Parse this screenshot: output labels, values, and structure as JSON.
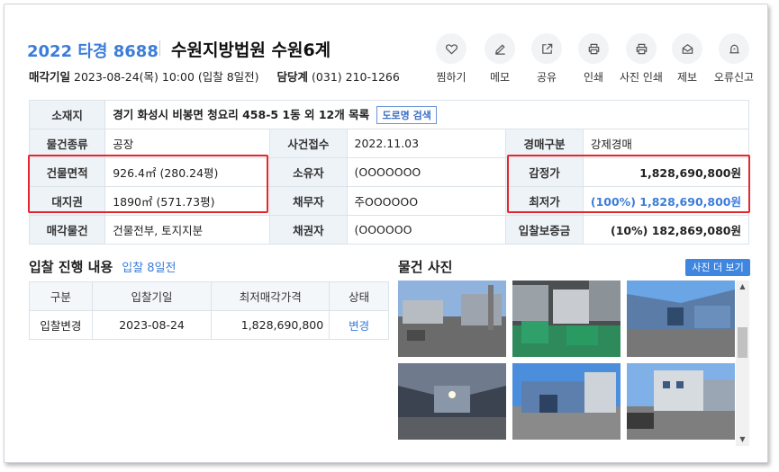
{
  "header": {
    "case_no": "2022 타경 8688",
    "court": "수원지방법원 수원6계",
    "sale_date_label": "매각기일",
    "sale_date": "2023-08-24(목) 10:00 (입찰 8일전)",
    "manager_label": "담당계",
    "manager_phone": "(031) 210-1266"
  },
  "actions": [
    {
      "label": "찜하기",
      "icon": "heart-icon"
    },
    {
      "label": "메모",
      "icon": "edit-icon"
    },
    {
      "label": "공유",
      "icon": "share-icon"
    },
    {
      "label": "인쇄",
      "icon": "print-icon"
    },
    {
      "label": "사진 인쇄",
      "icon": "print-icon"
    },
    {
      "label": "제보",
      "icon": "mail-icon"
    },
    {
      "label": "오류신고",
      "icon": "alert-icon"
    }
  ],
  "info": {
    "location_label": "소재지",
    "location": "경기 화성시 비봉면 청요리 458-5 1동 외 12개 목록",
    "road_btn": "도로명 검색",
    "type_label": "물건종류",
    "type": "공장",
    "accept_label": "사건접수",
    "accept": "2022.11.03",
    "auction_kind_label": "경매구분",
    "auction_kind": "강제경매",
    "bldg_area_label": "건물면적",
    "bldg_area": "926.4㎡ (280.24평)",
    "owner_label": "소유자",
    "owner": "(OOOOOOO",
    "appraisal_label": "감정가",
    "appraisal": "1,828,690,800원",
    "land_label": "대지권",
    "land": "1890㎡ (571.73평)",
    "debtor_label": "채무자",
    "debtor": "주OOOOOO",
    "min_price_label": "최저가",
    "min_price": "(100%) 1,828,690,800원",
    "sale_item_label": "매각물건",
    "sale_item": "건물전부, 토지지분",
    "creditor_label": "채권자",
    "creditor": "(OOOOOO",
    "deposit_label": "입찰보증금",
    "deposit": "(10%) 182,869,080원"
  },
  "bidding": {
    "title": "입찰 진행 내용",
    "sub": "입찰 8일전",
    "columns": [
      "구분",
      "입찰기일",
      "최저매각가격",
      "상태"
    ],
    "rows": [
      {
        "kind": "입찰변경",
        "date": "2023-08-24",
        "price": "1,828,690,800",
        "status": "변경"
      }
    ]
  },
  "photos": {
    "title": "물건 사진",
    "more_btn": "사진 더 보기"
  },
  "colors": {
    "accent": "#3c7dd9",
    "highlight": "#e5262c",
    "header_bg": "#eef3f8"
  }
}
